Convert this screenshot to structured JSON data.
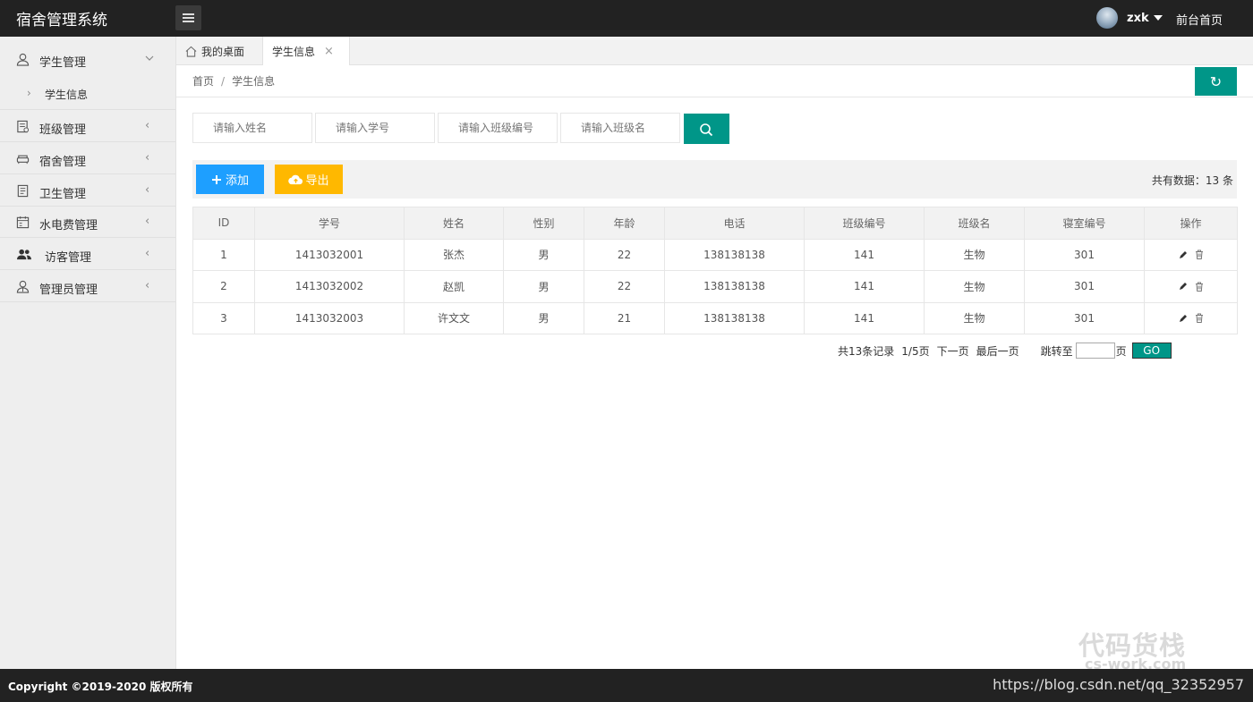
{
  "header": {
    "logo": "宿舍管理系统",
    "username": "zxk",
    "front_link": "前台首页"
  },
  "sidebar": {
    "items": [
      {
        "label": "学生管理",
        "icon": "user-icon"
      },
      {
        "label": "班级管理",
        "icon": "class-icon"
      },
      {
        "label": "宿舍管理",
        "icon": "sofa-icon"
      },
      {
        "label": "卫生管理",
        "icon": "clipboard-icon"
      },
      {
        "label": "水电费管理",
        "icon": "calendar-icon"
      },
      {
        "label": "访客管理",
        "icon": "users-icon"
      },
      {
        "label": "管理员管理",
        "icon": "admin-icon"
      }
    ],
    "sub_item": "学生信息"
  },
  "tabs": {
    "home": "我的桌面",
    "active": "学生信息",
    "close": "×"
  },
  "breadcrumb": {
    "home": "首页",
    "sep": "/",
    "current": "学生信息"
  },
  "refresh_symbol": "↻",
  "search": {
    "name_placeholder": "请输入姓名",
    "id_placeholder": "请输入学号",
    "class_no_placeholder": "请输入班级编号",
    "class_name_placeholder": "请输入班级名"
  },
  "toolbar": {
    "add_label": "添加",
    "export_label": "导出",
    "total": "共有数据：13 条"
  },
  "table": {
    "headers": [
      "ID",
      "学号",
      "姓名",
      "性别",
      "年龄",
      "电话",
      "班级编号",
      "班级名",
      "寝室编号",
      "操作"
    ],
    "rows": [
      [
        "1",
        "1413032001",
        "张杰",
        "男",
        "22",
        "138138138",
        "141",
        "生物",
        "301"
      ],
      [
        "2",
        "1413032002",
        "赵凯",
        "男",
        "22",
        "138138138",
        "141",
        "生物",
        "301"
      ],
      [
        "3",
        "1413032003",
        "许文文",
        "男",
        "21",
        "138138138",
        "141",
        "生物",
        "301"
      ]
    ]
  },
  "pagination": {
    "total_records": "共13条记录",
    "page_info": "1/5页",
    "next": "下一页",
    "last": "最后一页",
    "jump_to": "跳转至",
    "page_unit": "页",
    "go": "GO"
  },
  "watermark": {
    "cn": "代码货栈",
    "en": "cs-work.com"
  },
  "footer": {
    "copyright": "Copyright ©2019-2020 版权所有",
    "blog_url": "https://blog.csdn.net/qq_32352957"
  },
  "colors": {
    "accent": "#009688",
    "add": "#1E9FFF",
    "export": "#FFB800",
    "header": "#222222"
  }
}
